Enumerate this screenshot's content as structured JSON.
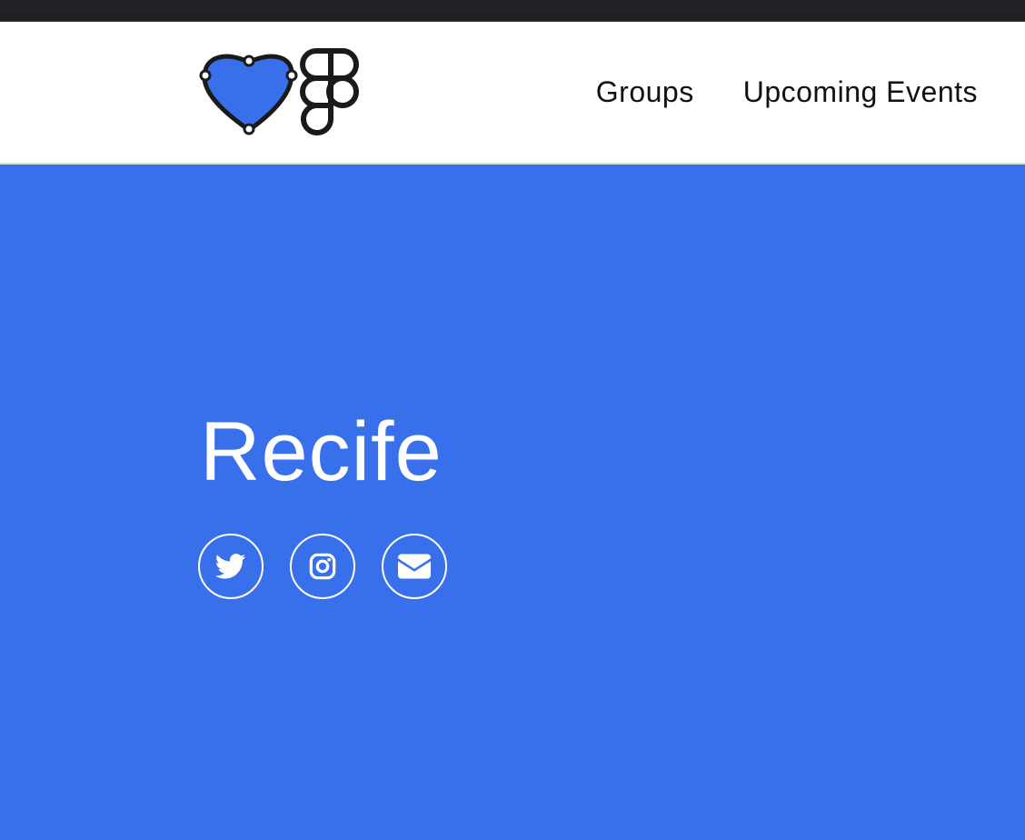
{
  "nav": {
    "links": [
      {
        "label": "Groups"
      },
      {
        "label": "Upcoming Events"
      }
    ]
  },
  "hero": {
    "title": "Recife",
    "background_color": "#3870ec",
    "social": [
      {
        "icon": "twitter-icon"
      },
      {
        "icon": "instagram-icon"
      },
      {
        "icon": "email-icon"
      }
    ]
  },
  "logo": {
    "icons": [
      "heart-icon",
      "figma-icon"
    ],
    "heart_color": "#3870ec"
  }
}
